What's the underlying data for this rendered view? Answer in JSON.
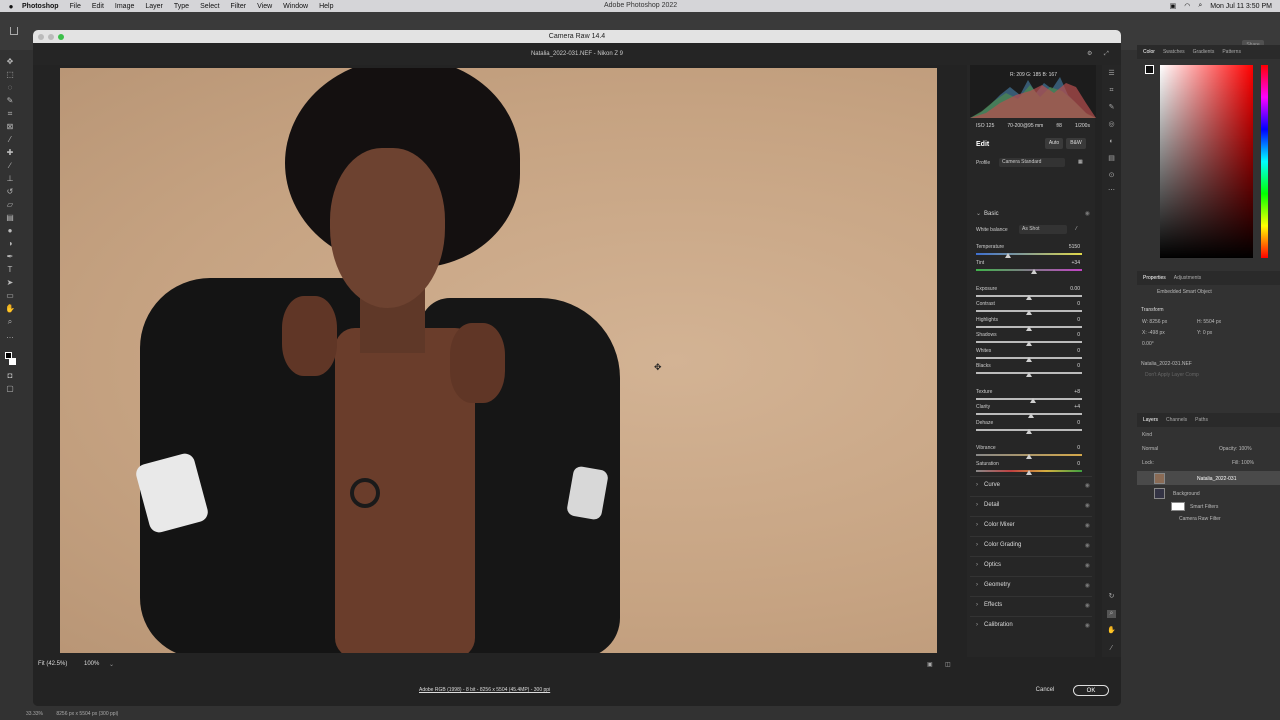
{
  "menubar": {
    "apple": "",
    "app": "Photoshop",
    "items": [
      "File",
      "Edit",
      "Image",
      "Layer",
      "Type",
      "Select",
      "Filter",
      "View",
      "Window",
      "Help"
    ],
    "window_title": "Adobe Photoshop 2022",
    "datetime": "Mon Jul 11  3:50 PM"
  },
  "ps": {
    "share": "Share"
  },
  "camera_raw": {
    "title": "Camera Raw 14.4",
    "file_info": "Natalia_2022-031.NEF  -  Nikon Z 9",
    "zoom_fit": "Fit (42.5%)",
    "zoom_100": "100%",
    "workflow": "Adobe RGB (1998) - 8 bit - 8256 x 5504 (45.4MP) - 300 ppi",
    "cancel": "Cancel",
    "ok": "OK",
    "histogram": {
      "r": "R: 209",
      "g": "G: 185",
      "b": "B: 167"
    },
    "meta": {
      "iso": "ISO 125",
      "lens": "70-200@95 mm",
      "aperture": "f/8",
      "shutter": "1/200s"
    },
    "edit_label": "Edit",
    "auto": "Auto",
    "bw": "B&W",
    "profile_label": "Profile",
    "profile_value": "Camera Standard",
    "basic": {
      "title": "Basic",
      "wb_label": "White balance",
      "wb_value": "As Shot",
      "sliders": [
        {
          "label": "Temperature",
          "value": "5150",
          "pos": 0.3
        },
        {
          "label": "Tint",
          "value": "+34",
          "pos": 0.55
        },
        {
          "label": "Exposure",
          "value": "0.00",
          "pos": 0.5
        },
        {
          "label": "Contrast",
          "value": "0",
          "pos": 0.5
        },
        {
          "label": "Highlights",
          "value": "0",
          "pos": 0.5
        },
        {
          "label": "Shadows",
          "value": "0",
          "pos": 0.5
        },
        {
          "label": "Whites",
          "value": "0",
          "pos": 0.5
        },
        {
          "label": "Blacks",
          "value": "0",
          "pos": 0.5
        },
        {
          "label": "Texture",
          "value": "+8",
          "pos": 0.54
        },
        {
          "label": "Clarity",
          "value": "+4",
          "pos": 0.52
        },
        {
          "label": "Dehaze",
          "value": "0",
          "pos": 0.5
        },
        {
          "label": "Vibrance",
          "value": "0",
          "pos": 0.5
        },
        {
          "label": "Saturation",
          "value": "0",
          "pos": 0.5
        }
      ]
    },
    "sections": [
      "Curve",
      "Detail",
      "Color Mixer",
      "Color Grading",
      "Optics",
      "Geometry",
      "Effects",
      "Calibration"
    ]
  },
  "panels": {
    "color_tabs": [
      "Color",
      "Swatches",
      "Gradients",
      "Patterns"
    ],
    "props_tabs": [
      "Properties",
      "Adjustments"
    ],
    "embedded": "Embedded Smart Object",
    "transform": "Transform",
    "w": "W: 8256 px",
    "h": "H: 5504 px",
    "x": "X: -498 px",
    "y": "Y: 0 px",
    "angle": "0.00°",
    "filename": "Natalia_2022-031.NEF",
    "layer_comp": "Don't Apply Layer Comp",
    "layer_tabs": [
      "Layers",
      "Channels",
      "Paths"
    ],
    "kind": "Kind",
    "blend": "Normal",
    "opacity": "Opacity: 100%",
    "lock": "Lock:",
    "fill": "Fill: 100%",
    "layers": [
      "Natalia_2022-031",
      "Background",
      "Smart Filters",
      "Camera Raw Filter"
    ]
  },
  "status": {
    "zoom": "33.33%",
    "doc": "8256 px x 5504 px (300 ppi)"
  }
}
